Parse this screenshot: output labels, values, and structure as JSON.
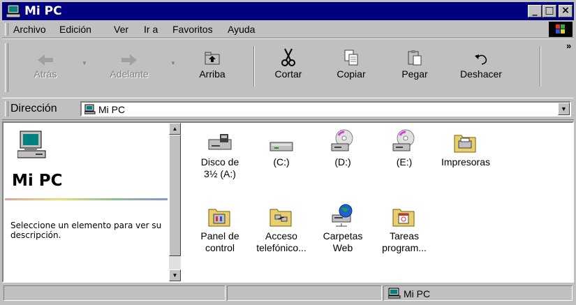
{
  "window": {
    "title": "Mi PC"
  },
  "menu": {
    "items": [
      "Archivo",
      "Edición",
      "Ver",
      "Ir a",
      "Favoritos",
      "Ayuda"
    ]
  },
  "toolbar": {
    "buttons": [
      {
        "label": "Atrás",
        "icon": "back-arrow-icon",
        "enabled": false
      },
      {
        "label": "Adelante",
        "icon": "forward-arrow-icon",
        "enabled": false
      },
      {
        "label": "Arriba",
        "icon": "up-folder-icon",
        "enabled": true
      },
      {
        "label": "Cortar",
        "icon": "scissors-icon",
        "enabled": true
      },
      {
        "label": "Copiar",
        "icon": "copy-icon",
        "enabled": true
      },
      {
        "label": "Pegar",
        "icon": "paste-icon",
        "enabled": true
      },
      {
        "label": "Deshacer",
        "icon": "undo-icon",
        "enabled": true
      }
    ],
    "overflow": "»"
  },
  "address": {
    "label": "Dirección",
    "value": "Mi PC"
  },
  "left_pane": {
    "title": "Mi PC",
    "description": "Seleccione un elemento para ver su descripción."
  },
  "items": [
    {
      "label": "Disco de\n3½ (A:)",
      "icon": "floppy-drive-icon"
    },
    {
      "label": "(C:)",
      "icon": "hard-disk-icon"
    },
    {
      "label": "(D:)",
      "icon": "cd-drive-icon"
    },
    {
      "label": "(E:)",
      "icon": "cd-drive-icon"
    },
    {
      "label": "Impresoras",
      "icon": "printers-folder-icon"
    },
    {
      "label": "Panel de\ncontrol",
      "icon": "control-panel-folder-icon"
    },
    {
      "label": "Acceso\ntelefónico...",
      "icon": "dial-up-folder-icon"
    },
    {
      "label": "Carpetas\nWeb",
      "icon": "web-folders-icon"
    },
    {
      "label": "Tareas\nprogram...",
      "icon": "scheduled-tasks-folder-icon"
    }
  ],
  "status": {
    "zone": "Mi PC"
  },
  "colors": {
    "titlebar": "#000080",
    "face": "#c0c0c0"
  }
}
